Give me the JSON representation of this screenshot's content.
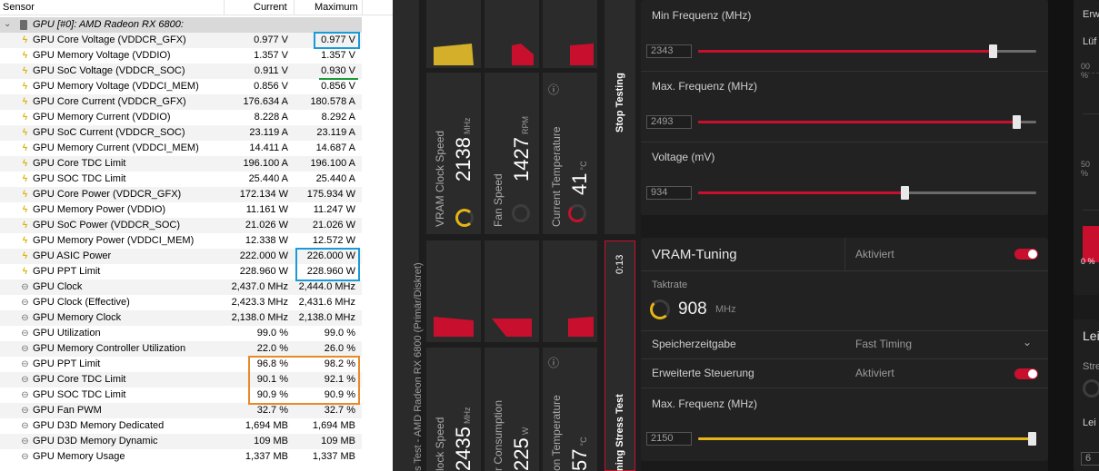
{
  "hwinfo": {
    "columns": {
      "sensor": "Sensor",
      "current": "Current",
      "maximum": "Maximum"
    },
    "group": "GPU [#0]: AMD Radeon RX 6800:",
    "rows": [
      {
        "name": "GPU Core Voltage (VDDCR_GFX)",
        "current": "0.977 V",
        "max": "0.977 V",
        "icon": "bolt"
      },
      {
        "name": "GPU Memory Voltage (VDDIO)",
        "current": "1.357 V",
        "max": "1.357 V",
        "icon": "bolt"
      },
      {
        "name": "GPU SoC Voltage (VDDCR_SOC)",
        "current": "0.911 V",
        "max": "0.930 V",
        "icon": "bolt"
      },
      {
        "name": "GPU Memory Voltage (VDDCI_MEM)",
        "current": "0.856 V",
        "max": "0.856 V",
        "icon": "bolt"
      },
      {
        "name": "GPU Core Current (VDDCR_GFX)",
        "current": "176.634 A",
        "max": "180.578 A",
        "icon": "bolt"
      },
      {
        "name": "GPU Memory Current (VDDIO)",
        "current": "8.228 A",
        "max": "8.292 A",
        "icon": "bolt"
      },
      {
        "name": "GPU SoC Current (VDDCR_SOC)",
        "current": "23.119 A",
        "max": "23.119 A",
        "icon": "bolt"
      },
      {
        "name": "GPU Memory Current (VDDCI_MEM)",
        "current": "14.411 A",
        "max": "14.687 A",
        "icon": "bolt"
      },
      {
        "name": "GPU Core TDC Limit",
        "current": "196.100 A",
        "max": "196.100 A",
        "icon": "bolt"
      },
      {
        "name": "GPU SOC TDC Limit",
        "current": "25.440 A",
        "max": "25.440 A",
        "icon": "bolt"
      },
      {
        "name": "GPU Core Power (VDDCR_GFX)",
        "current": "172.134 W",
        "max": "175.934 W",
        "icon": "bolt"
      },
      {
        "name": "GPU Memory Power (VDDIO)",
        "current": "11.161 W",
        "max": "11.247 W",
        "icon": "bolt"
      },
      {
        "name": "GPU SoC Power (VDDCR_SOC)",
        "current": "21.026 W",
        "max": "21.026 W",
        "icon": "bolt"
      },
      {
        "name": "GPU Memory Power (VDDCI_MEM)",
        "current": "12.338 W",
        "max": "12.572 W",
        "icon": "bolt"
      },
      {
        "name": "GPU ASIC Power",
        "current": "222.000 W",
        "max": "226.000 W",
        "icon": "bolt"
      },
      {
        "name": "GPU PPT Limit",
        "current": "228.960 W",
        "max": "228.960 W",
        "icon": "bolt"
      },
      {
        "name": "GPU Clock",
        "current": "2,437.0 MHz",
        "max": "2,444.0 MHz",
        "icon": "clock"
      },
      {
        "name": "GPU Clock (Effective)",
        "current": "2,423.3 MHz",
        "max": "2,431.6 MHz",
        "icon": "clock"
      },
      {
        "name": "GPU Memory Clock",
        "current": "2,138.0 MHz",
        "max": "2,138.0 MHz",
        "icon": "clock"
      },
      {
        "name": "GPU Utilization",
        "current": "99.0 %",
        "max": "99.0 %",
        "icon": "clock"
      },
      {
        "name": "GPU Memory Controller Utilization",
        "current": "22.0 %",
        "max": "26.0 %",
        "icon": "clock"
      },
      {
        "name": "GPU PPT Limit",
        "current": "96.8 %",
        "max": "98.2 %",
        "icon": "clock"
      },
      {
        "name": "GPU Core TDC Limit",
        "current": "90.1 %",
        "max": "92.1 %",
        "icon": "clock"
      },
      {
        "name": "GPU SOC TDC Limit",
        "current": "90.9 %",
        "max": "90.9 %",
        "icon": "clock"
      },
      {
        "name": "GPU Fan PWM",
        "current": "32.7 %",
        "max": "32.7 %",
        "icon": "clock"
      },
      {
        "name": "GPU D3D Memory Dedicated",
        "current": "1,694 MB",
        "max": "1,694 MB",
        "icon": "clock"
      },
      {
        "name": "GPU D3D Memory Dynamic",
        "current": "109 MB",
        "max": "109 MB",
        "icon": "clock"
      },
      {
        "name": "GPU Memory Usage",
        "current": "1,337 MB",
        "max": "1,337 MB",
        "icon": "clock"
      }
    ],
    "highlight_colors": {
      "blue": "#1a9ad6",
      "green": "#1e9a3a",
      "orange": "#e8892a"
    }
  },
  "stress": {
    "side_title": "s Test - AMD Radeon RX 6800 (Primär/Diskret)",
    "stop_label": "Stop Testing",
    "timer": "0:13",
    "running_label": "ning Stress Test",
    "top_metrics": [
      {
        "label": "VRAM Clock Speed",
        "value": "2138",
        "unit": "MHz"
      },
      {
        "label": "Fan Speed",
        "value": "1427",
        "unit": "RPM"
      },
      {
        "label": "Current Temperature",
        "value": "41",
        "unit": "°C"
      }
    ],
    "bottom_metrics": [
      {
        "label": "lock Speed",
        "value": "2435",
        "unit": "MHz"
      },
      {
        "label": "r Consumption",
        "value": "225",
        "unit": "W"
      },
      {
        "label": "on Temperature",
        "value": "57",
        "unit": "°C"
      }
    ],
    "accent_red": "#c8102e",
    "accent_yellow": "#d4b02a"
  },
  "tuning": {
    "min_freq": {
      "label": "Min Frequenz (MHz)",
      "value": "2343",
      "level": 0.87
    },
    "max_freq": {
      "label": "Max. Frequenz (MHz)",
      "value": "2493",
      "level": 0.94
    },
    "voltage": {
      "label": "Voltage (mV)",
      "value": "934",
      "level": 0.61
    },
    "vram": {
      "title": "VRAM-Tuning",
      "status": "Aktiviert",
      "clock_label": "Taktrate",
      "clock_value": "908",
      "clock_unit": "MHz",
      "timing_label": "Speicherzeitgabe",
      "timing_value": "Fast Timing",
      "adv_label": "Erweiterte Steuerung",
      "adv_status": "Aktiviert",
      "max_freq_label": "Max. Frequenz (MHz)",
      "max_freq_value": "2150",
      "max_freq_level": 1.0
    },
    "right": {
      "top_label": "Erw",
      "sub_label": "Lüf",
      "pct_top": "00 %",
      "pct_mid": "50 %",
      "pct_bot": "0 %",
      "lei_label": "Lei",
      "str_label": "Stre",
      "lei2_label": "Lei",
      "small_val": "6"
    }
  }
}
